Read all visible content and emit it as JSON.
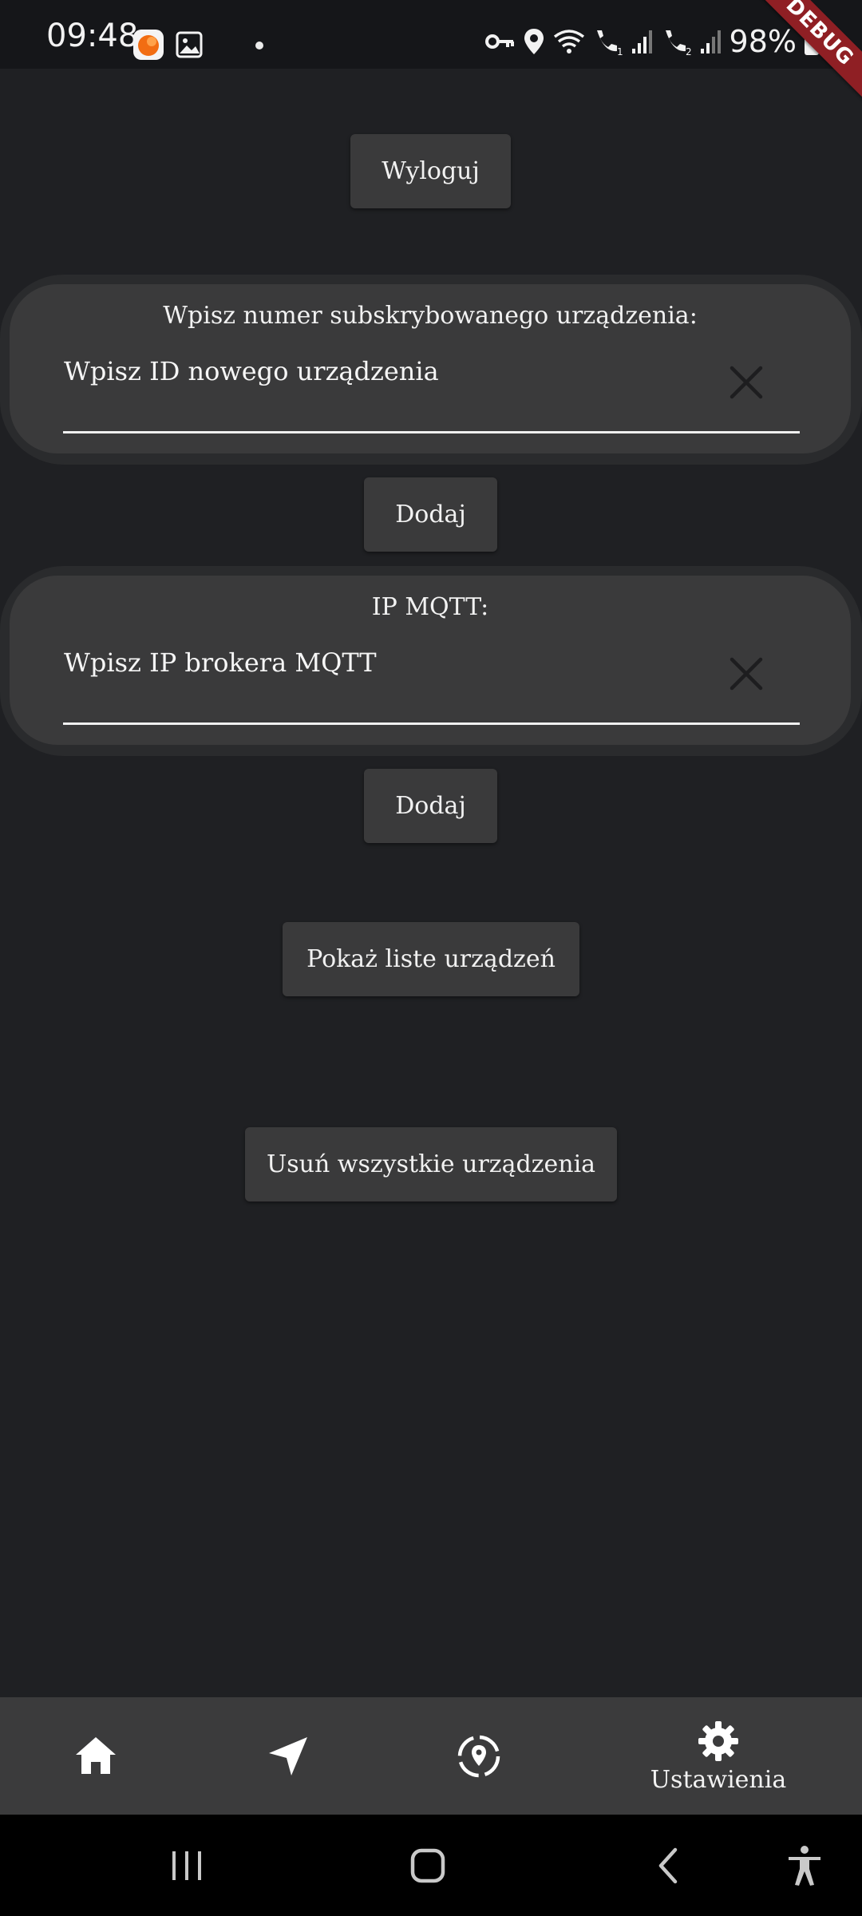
{
  "status_bar": {
    "time": "09:48",
    "battery": "98%",
    "debug_label": "DEBUG",
    "icons": [
      "app-notification-icon",
      "image-icon",
      "vpn-key-icon",
      "location-icon",
      "wifi-icon",
      "wifi-call-1-icon",
      "signal-1-icon",
      "wifi-call-2-icon",
      "signal-2-icon",
      "battery-icon"
    ]
  },
  "logout_button": {
    "label": "Wyloguj"
  },
  "device_card": {
    "label": "Wpisz numer subskrybowanego urządzenia:",
    "placeholder": "Wpisz ID nowego urządzenia",
    "add_label": "Dodaj"
  },
  "mqtt_card": {
    "label": "IP MQTT:",
    "placeholder": "Wpisz IP brokera MQTT",
    "add_label": "Dodaj"
  },
  "show_devices_button": {
    "label": "Pokaż liste urządzeń"
  },
  "delete_all_button": {
    "label": "Usuń wszystkie urządzenia"
  },
  "bottom_nav": {
    "items": [
      {
        "icon": "home-icon",
        "label": ""
      },
      {
        "icon": "navigation-arrow-icon",
        "label": ""
      },
      {
        "icon": "location-target-icon",
        "label": ""
      },
      {
        "icon": "gear-icon",
        "label": "Ustawienia",
        "active": true
      }
    ]
  },
  "system_nav": {
    "icons": [
      "recent-apps-icon",
      "home-circle-icon",
      "back-icon",
      "accessibility-icon"
    ]
  },
  "colors": {
    "background": "#1f2023",
    "card": "#3a3a3b",
    "nav_bar": "#3b3b3c",
    "debug_banner": "#8f1f24"
  }
}
